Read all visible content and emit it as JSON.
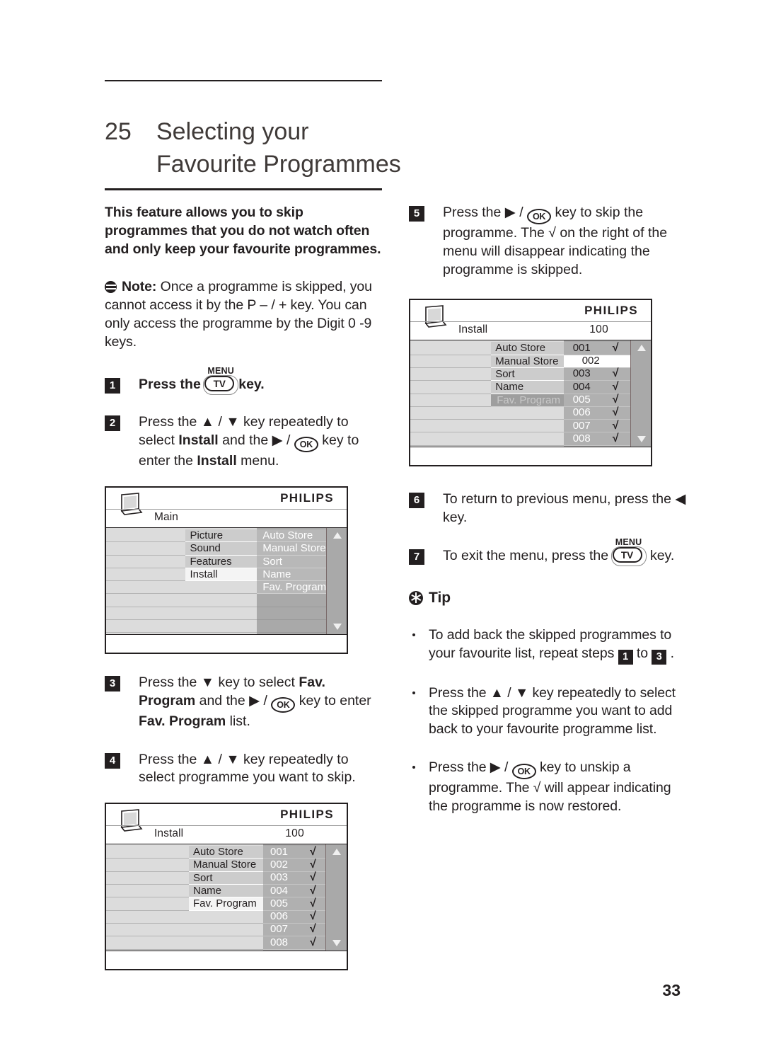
{
  "chapter": {
    "number": "25",
    "title_line1": "Selecting your",
    "title_line2": "Favourite Programmes"
  },
  "intro": "This feature allows you to skip programmes that you do not watch often and only keep your favourite programmes.",
  "note": {
    "icon": "note-icon",
    "label": "Note:",
    "text": " Once a programme is skipped, you cannot access it by the P – / + key. You can only access the programme by the Digit 0 -9 keys."
  },
  "steps": [
    {
      "num": "1",
      "parts": [
        "Press the ",
        "key."
      ],
      "key": "TV",
      "key_label": "MENU"
    },
    {
      "num": "2",
      "text_a": "Press the ▲ / ▼ key repeatedly to select ",
      "bold_a": "Install",
      "text_b": " and the ▶ / ",
      "key": "OK",
      "text_c": " key to enter the ",
      "bold_b": "Install",
      "text_d": " menu."
    },
    {
      "num": "3",
      "text_a": "Press the ▼ key to select ",
      "bold_a": "Fav. Program",
      "text_b": " and the ▶ / ",
      "key": "OK",
      "text_c": " key to enter ",
      "bold_b": "Fav. Program",
      "text_d": " list."
    },
    {
      "num": "4",
      "text_a": "Press the ▲ / ▼ key repeatedly to select programme you want to skip."
    },
    {
      "num": "5",
      "text_a": "Press the ▶ / ",
      "key": "OK",
      "text_b": " key  to skip the programme. The √ on the right of the menu will disappear indicating the programme is skipped."
    },
    {
      "num": "6",
      "text_a": "To return to previous menu, press the ◀ key."
    },
    {
      "num": "7",
      "text_a": "To exit the menu, press the ",
      "key": "TV",
      "key_label": "MENU",
      "text_b": " key."
    }
  ],
  "tip": {
    "icon": "asterisk-icon",
    "heading": "Tip",
    "bullets": [
      {
        "text_a": "To add back the skipped programmes to your favourite list, repeat steps ",
        "step_from": "1",
        "text_b": " to ",
        "step_to": "3",
        "text_c": " ."
      },
      {
        "text_a": "Press the ▲ / ▼ key repeatedly to select the skipped programme you want to add back to your favourite programme list."
      },
      {
        "text_a": "Press the  ▶ / ",
        "key": "OK",
        "text_b": "  key to unskip a programme. The √ will appear indicating the programme is now restored."
      }
    ]
  },
  "osd_menus": [
    {
      "id": "osd-main",
      "brand": "PHILIPS",
      "title": "Main",
      "count": "",
      "col_left": [
        {
          "label": "Picture",
          "state": "normal"
        },
        {
          "label": "Sound",
          "state": "normal"
        },
        {
          "label": "Features",
          "state": "normal"
        },
        {
          "label": "Install",
          "state": "selected"
        },
        {
          "label": "",
          "state": "blank"
        },
        {
          "label": "",
          "state": "blank"
        },
        {
          "label": "",
          "state": "blank"
        },
        {
          "label": "",
          "state": "blank"
        }
      ],
      "col_right": [
        {
          "label": "Auto Store",
          "state": "normal"
        },
        {
          "label": "Manual Store",
          "state": "normal"
        },
        {
          "label": "Sort",
          "state": "normal"
        },
        {
          "label": "Name",
          "state": "normal"
        },
        {
          "label": "Fav. Program",
          "state": "normal"
        },
        {
          "label": "",
          "state": "blank"
        },
        {
          "label": "",
          "state": "blank"
        },
        {
          "label": "",
          "state": "blank"
        }
      ],
      "scroll_up": "△",
      "scroll_down": "▽"
    },
    {
      "id": "osd-install-list",
      "brand": "PHILIPS",
      "title": "Install",
      "count": "100",
      "col_left": [
        {
          "label": "Auto Store",
          "state": "normal"
        },
        {
          "label": "Manual Store",
          "state": "normal"
        },
        {
          "label": "Sort",
          "state": "normal"
        },
        {
          "label": "Name",
          "state": "normal"
        },
        {
          "label": "Fav. Program",
          "state": "selected"
        },
        {
          "label": "",
          "state": "blank"
        },
        {
          "label": "",
          "state": "blank"
        },
        {
          "label": "",
          "state": "blank"
        }
      ],
      "programmes": [
        {
          "num": "001",
          "check": "√",
          "state": "normal"
        },
        {
          "num": "002",
          "check": "√",
          "state": "normal"
        },
        {
          "num": "003",
          "check": "√",
          "state": "normal"
        },
        {
          "num": "004",
          "check": "√",
          "state": "normal"
        },
        {
          "num": "005",
          "check": "√",
          "state": "normal"
        },
        {
          "num": "006",
          "check": "√",
          "state": "normal"
        },
        {
          "num": "007",
          "check": "√",
          "state": "normal"
        },
        {
          "num": "008",
          "check": "√",
          "state": "normal"
        }
      ],
      "scroll_up": "△",
      "scroll_down": "▽"
    },
    {
      "id": "osd-skipped-list",
      "brand": "PHILIPS",
      "title": "Install",
      "count": "100",
      "col_left": [
        {
          "label": "Auto Store",
          "state": "normal"
        },
        {
          "label": "Manual Store",
          "state": "normal"
        },
        {
          "label": "Sort",
          "state": "normal"
        },
        {
          "label": "Name",
          "state": "normal"
        },
        {
          "label": "Fav. Program",
          "state": "dim"
        },
        {
          "label": "",
          "state": "blank"
        },
        {
          "label": "",
          "state": "blank"
        },
        {
          "label": "",
          "state": "blank"
        }
      ],
      "programmes": [
        {
          "num": "001",
          "check": "√",
          "state": "dark"
        },
        {
          "num": "002",
          "check": "",
          "state": "highlighted"
        },
        {
          "num": "003",
          "check": "√",
          "state": "dark"
        },
        {
          "num": "004",
          "check": "√",
          "state": "dark"
        },
        {
          "num": "005",
          "check": "√",
          "state": "normal"
        },
        {
          "num": "006",
          "check": "√",
          "state": "normal"
        },
        {
          "num": "007",
          "check": "√",
          "state": "normal"
        },
        {
          "num": "008",
          "check": "√",
          "state": "normal"
        }
      ],
      "scroll_up": "△",
      "scroll_down": "▽"
    }
  ],
  "page_number": "33",
  "colors": {
    "text": "#231f20",
    "osd_light": "#dcdcdc",
    "osd_mid": "#cccccc",
    "osd_dark": "#a9a9a9",
    "osd_selected": "#f4f4f4"
  }
}
